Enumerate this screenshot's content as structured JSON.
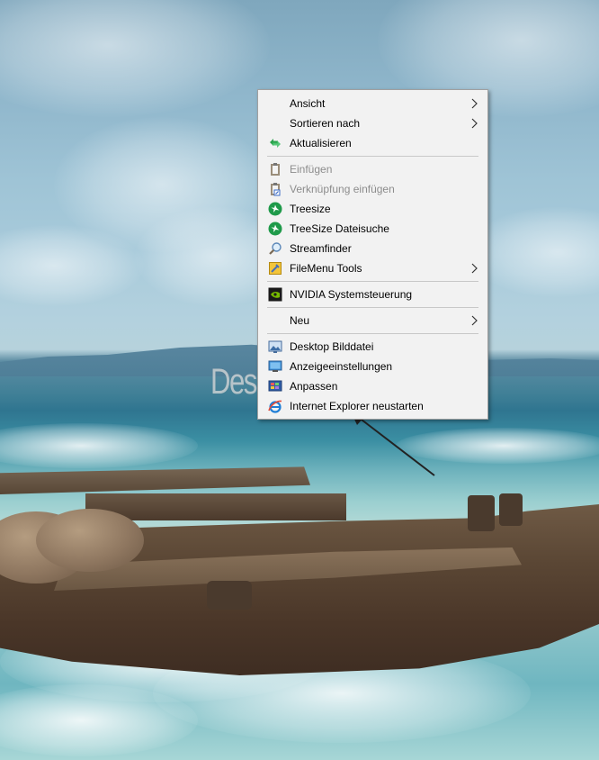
{
  "context_menu": {
    "items": [
      {
        "label": "Ansicht",
        "icon": "none",
        "submenu": true,
        "disabled": false
      },
      {
        "label": "Sortieren nach",
        "icon": "none",
        "submenu": true,
        "disabled": false
      },
      {
        "label": "Aktualisieren",
        "icon": "refresh-icon",
        "submenu": false,
        "disabled": false
      },
      {
        "label": "Einfügen",
        "icon": "paste-icon",
        "submenu": false,
        "disabled": true
      },
      {
        "label": "Verknüpfung einfügen",
        "icon": "paste-shortcut-icon",
        "submenu": false,
        "disabled": true
      },
      {
        "label": "Treesize",
        "icon": "treesize-icon",
        "submenu": false,
        "disabled": false
      },
      {
        "label": "TreeSize Dateisuche",
        "icon": "treesize-search-icon",
        "submenu": false,
        "disabled": false
      },
      {
        "label": "Streamfinder",
        "icon": "magnifier-icon",
        "submenu": false,
        "disabled": false
      },
      {
        "label": "FileMenu Tools",
        "icon": "filemenu-tools-icon",
        "submenu": true,
        "disabled": false
      },
      {
        "label": "NVIDIA Systemsteuerung",
        "icon": "nvidia-icon",
        "submenu": false,
        "disabled": false
      },
      {
        "label": "Neu",
        "icon": "none",
        "submenu": true,
        "disabled": false
      },
      {
        "label": "Desktop Bilddatei",
        "icon": "desktop-image-icon",
        "submenu": false,
        "disabled": false
      },
      {
        "label": "Anzeigeeinstellungen",
        "icon": "display-settings-icon",
        "submenu": false,
        "disabled": false
      },
      {
        "label": "Anpassen",
        "icon": "personalize-icon",
        "submenu": false,
        "disabled": false
      },
      {
        "label": "Internet Explorer neustarten",
        "icon": "internet-explorer-icon",
        "submenu": false,
        "disabled": false
      }
    ]
  },
  "watermark": {
    "text": "Deskmodder.de"
  },
  "colors": {
    "menu_background": "#f2f2f2",
    "menu_border": "#a0a0a0",
    "disabled_text": "#8d8d8d",
    "treesize_green": "#1f9a4a",
    "nvidia_green": "#76b900"
  }
}
